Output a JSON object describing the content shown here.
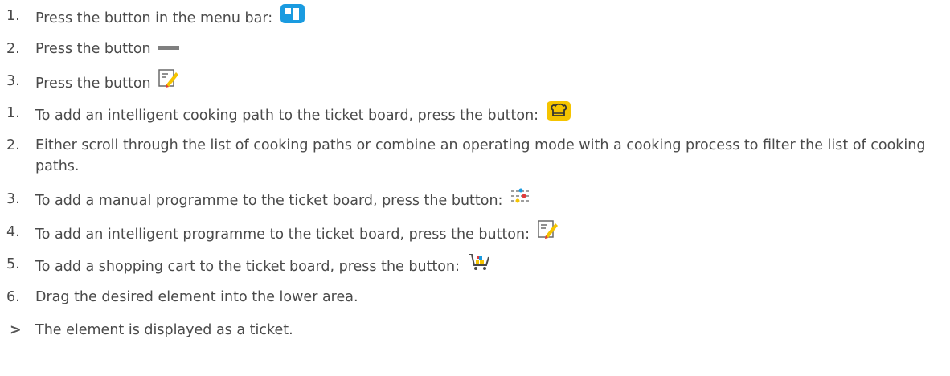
{
  "steps_group_1": [
    {
      "number": "1.",
      "text": "Press the button in the menu bar:",
      "icon": "ticket-board-icon"
    },
    {
      "number": "2.",
      "text": "Press the button",
      "icon": "minus-bar-icon"
    },
    {
      "number": "3.",
      "text": "Press the button",
      "icon": "edit-program-icon"
    }
  ],
  "steps_group_2": [
    {
      "number": "1.",
      "text": "To add an intelligent cooking path to the ticket board, press the button:",
      "icon": "cooking-path-icon"
    },
    {
      "number": "2.",
      "text": "Either scroll through the list of cooking paths or combine an operating mode with a cooking process to filter the list of cooking paths."
    },
    {
      "number": "3.",
      "text": "To add a manual programme to the ticket board, press the button:",
      "icon": "manual-programme-icon"
    },
    {
      "number": "4.",
      "text": "To add an intelligent programme to the ticket board, press the button:",
      "icon": "edit-program-icon"
    },
    {
      "number": "5.",
      "text": "To add a shopping cart to the ticket board, press the button:",
      "icon": "shopping-cart-icon"
    },
    {
      "number": "6.",
      "text": "Drag the desired element into the lower area."
    }
  ],
  "result": {
    "marker": ">",
    "text": "The element is displayed as a ticket."
  },
  "colors": {
    "text": "#4a4a4a",
    "blue": "#1a9be0",
    "yellow": "#f5c400",
    "gray": "#7f7f7f"
  }
}
